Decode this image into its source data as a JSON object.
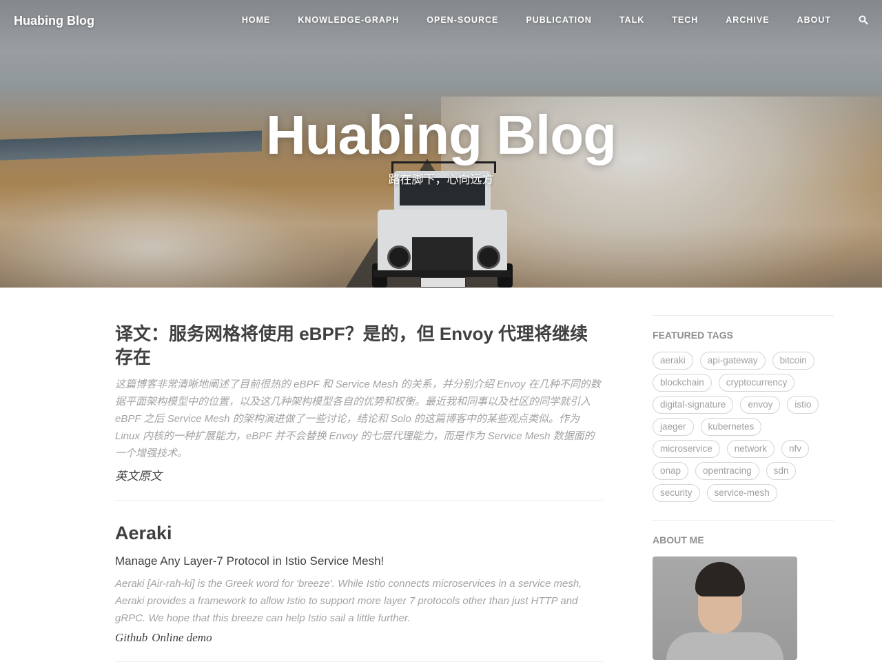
{
  "nav": {
    "brand": "Huabing Blog",
    "links": [
      "HOME",
      "KNOWLEDGE-GRAPH",
      "OPEN-SOURCE",
      "PUBLICATION",
      "TALK",
      "TECH",
      "ARCHIVE",
      "ABOUT"
    ],
    "search_icon": "search-icon"
  },
  "hero": {
    "title": "Huabing Blog",
    "subtitle": "路在脚下，心向远方"
  },
  "posts": [
    {
      "title": "译文：服务网格将使用 eBPF？是的，但 Envoy 代理将继续存在",
      "excerpt": "这篇博客非常清晰地阐述了目前很热的 eBPF 和 Service Mesh 的关系，并分别介绍 Envoy 在几种不同的数据平面架构模型中的位置，以及这几种架构模型各自的优势和权衡。最近我和同事以及社区的同学就引入 eBPF 之后 Service Mesh 的架构演进做了一些讨论，结论和 Solo 的这篇博客中的某些观点类似。作为 Linux 内核的一种扩展能力，eBPF 并不会替换 Envoy 的七层代理能力，而是作为 Service Mesh 数据面的一个增强技术。",
      "link": "英文原文"
    },
    {
      "title": "Aeraki",
      "subtitle": "Manage Any Layer-7 Protocol in Istio Service Mesh!",
      "excerpt": "Aeraki [Air-rah-ki] is the Greek word for 'breeze'. While Istio connects microservices in a service mesh, Aeraki provides a framework to allow Istio to support more layer 7 protocols other than just HTTP and gRPC. We hope that this breeze can help Istio sail a little further.",
      "links": [
        "Github",
        "Online demo"
      ]
    }
  ],
  "sidebar": {
    "featured_tags_heading": "FEATURED TAGS",
    "tags": [
      "aeraki",
      "api-gateway",
      "bitcoin",
      "blockchain",
      "cryptocurrency",
      "digital-signature",
      "envoy",
      "istio",
      "jaeger",
      "kubernetes",
      "microservice",
      "network",
      "nfv",
      "onap",
      "opentracing",
      "sdn",
      "security",
      "service-mesh"
    ],
    "about_heading": "ABOUT ME"
  }
}
